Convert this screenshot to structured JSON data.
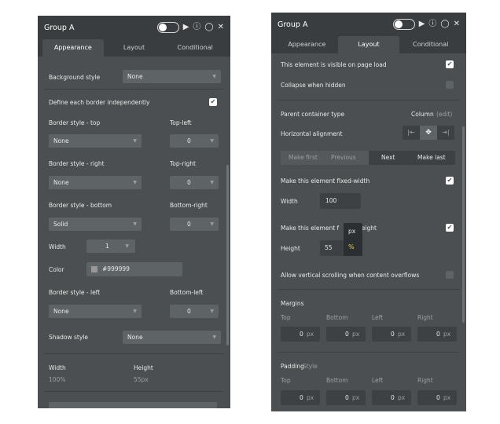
{
  "left": {
    "title": "Group A",
    "tabs": [
      "Appearance",
      "Layout",
      "Conditional"
    ],
    "background_style": {
      "label": "Background style",
      "value": "None"
    },
    "define_border": "Define each border independently",
    "top": {
      "label": "Border style - top",
      "corner": "Top-left",
      "value": "None",
      "corner_value": "0"
    },
    "right": {
      "label": "Border style - right",
      "corner": "Top-right",
      "value": "None",
      "corner_value": "0"
    },
    "bottom": {
      "label": "Border style - bottom",
      "corner": "Bottom-right",
      "value": "Solid",
      "corner_value": "0"
    },
    "width": {
      "label": "Width",
      "value": "1"
    },
    "color": {
      "label": "Color",
      "value": "#999999",
      "swatch": "#999999"
    },
    "left_border": {
      "label": "Border style - left",
      "corner": "Bottom-left",
      "value": "None",
      "corner_value": "0"
    },
    "shadow": {
      "label": "Shadow style",
      "value": "None"
    },
    "size": {
      "width_label": "Width",
      "width_value": "100%",
      "height_label": "Height",
      "height_value": "55px"
    }
  },
  "right": {
    "title": "Group A",
    "tabs": [
      "Appearance",
      "Layout",
      "Conditional"
    ],
    "visible": "This element is visible on page load",
    "collapse": "Collapse when hidden",
    "parent_type": "Parent container type",
    "parent_value": "Column",
    "parent_edit": "(edit)",
    "halign": "Horizontal alignment",
    "buttons": [
      "Make first",
      "Previous",
      "Next",
      "Make last"
    ],
    "fixed_width": "Make this element fixed-width",
    "width": {
      "label": "Width",
      "value": "100"
    },
    "fixed_height_a": "Make this element f",
    "fixed_height_b": "height",
    "height": {
      "label": "Height",
      "value": "55",
      "unit_options": [
        "px",
        "%"
      ]
    },
    "scroll": "Allow vertical scrolling when content overflows",
    "margins": {
      "title": "Margins",
      "labels": [
        "Top",
        "Bottom",
        "Left",
        "Right"
      ],
      "values": [
        "0",
        "0",
        "0",
        "0"
      ],
      "unit": "px"
    },
    "padding": {
      "title": "Padding",
      "style_link": "Style",
      "labels": [
        "Top",
        "Bottom",
        "Left",
        "Right"
      ],
      "values": [
        "0",
        "0",
        "0",
        "0"
      ],
      "unit": "px"
    }
  }
}
